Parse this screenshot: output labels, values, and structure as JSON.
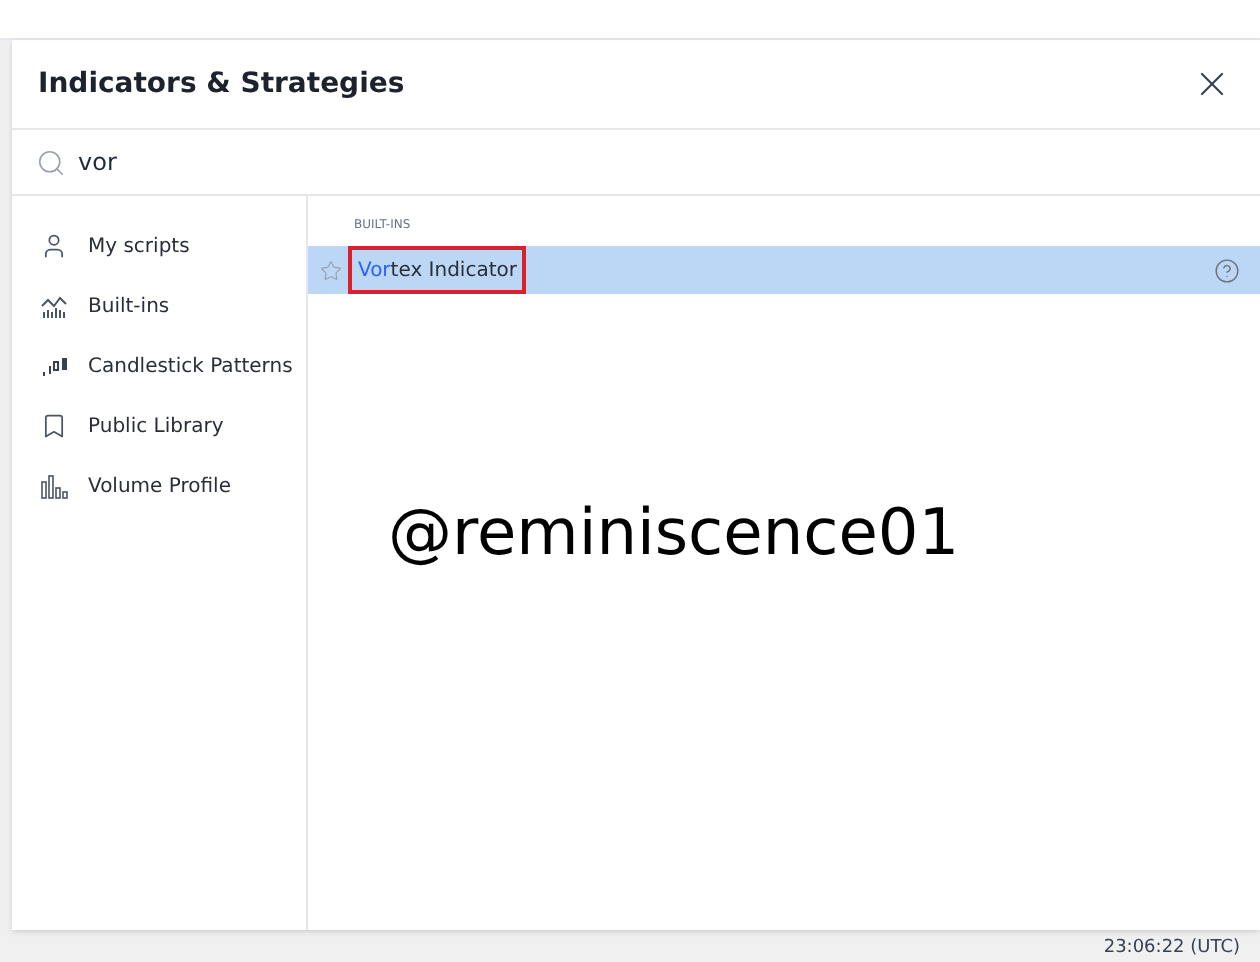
{
  "dialog": {
    "title": "Indicators & Strategies"
  },
  "search": {
    "value": "vor"
  },
  "sidebar": {
    "items": [
      {
        "label": "My scripts",
        "selected": false
      },
      {
        "label": "Built-ins",
        "selected": false
      },
      {
        "label": "Candlestick Patterns",
        "selected": false
      },
      {
        "label": "Public Library",
        "selected": false
      },
      {
        "label": "Volume Profile",
        "selected": false
      }
    ]
  },
  "results": {
    "section": "BUILT-INS",
    "items": [
      {
        "match": "Vor",
        "rest": "tex Indicator",
        "selected": true,
        "starred": false
      }
    ]
  },
  "overlay_text": "@reminiscence01",
  "status_bar": {
    "time": "23:06:22 (UTC)"
  }
}
